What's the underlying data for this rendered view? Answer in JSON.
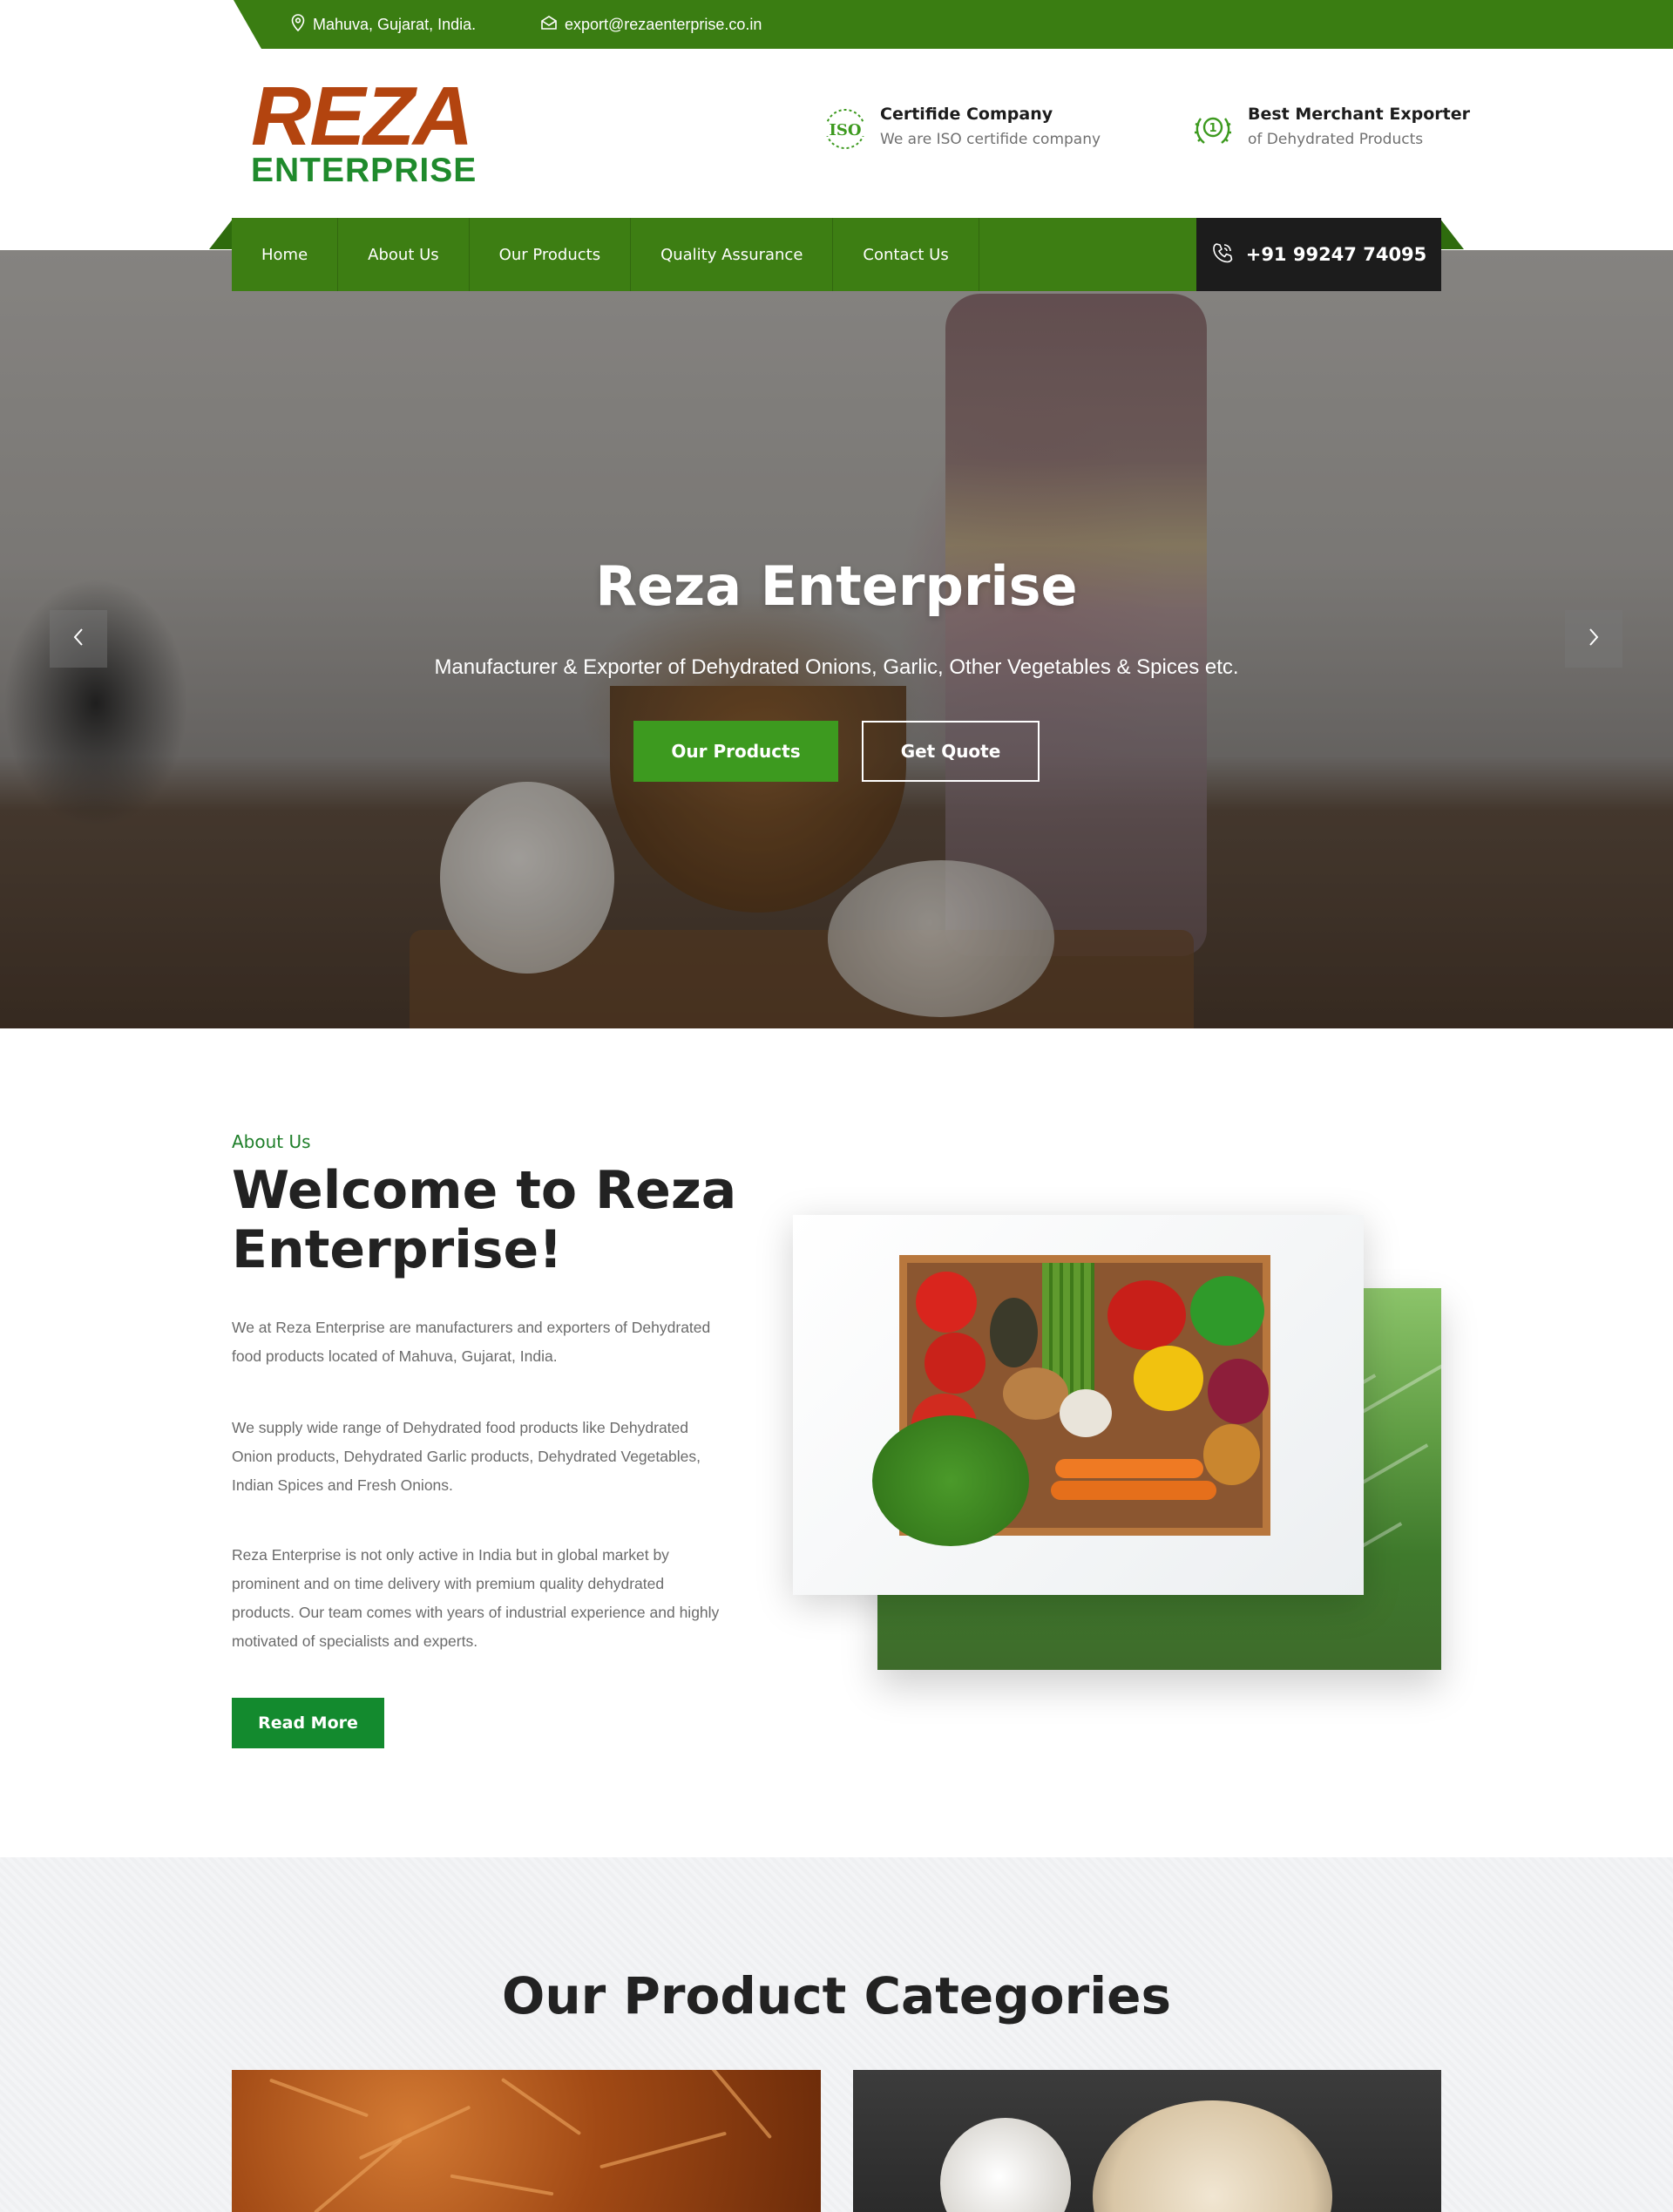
{
  "topbar": {
    "location": "Mahuva, Gujarat, India.",
    "email": "export@rezaenterprise.co.in",
    "location_icon": "map-pin-icon",
    "email_icon": "envelope-icon"
  },
  "logo": {
    "line1": "REZA",
    "line2": "ENTERPRISE"
  },
  "header_info": [
    {
      "title": "Certifide Company",
      "subtitle": "We are ISO certifide company",
      "icon": "iso-badge-icon",
      "icon_text": "ISO"
    },
    {
      "title": "Best Merchant Exporter",
      "subtitle": "of Dehydrated Products",
      "icon": "award-laurel-icon",
      "icon_text": "1"
    }
  ],
  "nav": {
    "items": [
      "Home",
      "About Us",
      "Our Products",
      "Quality Assurance",
      "Contact Us"
    ],
    "phone": "+91 99247 74095",
    "phone_icon": "phone-icon"
  },
  "hero": {
    "title": "Reza Enterprise",
    "subtitle": "Manufacturer & Exporter of Dehydrated Onions, Garlic, Other Vegetables & Spices etc.",
    "primary_button": "Our Products",
    "secondary_button": "Get Quote",
    "prev_icon": "chevron-left-icon",
    "next_icon": "chevron-right-icon"
  },
  "about": {
    "label": "About Us",
    "title": "Welcome to Reza Enterprise!",
    "paragraphs": [
      "We at Reza Enterprise are manufacturers and exporters of Dehydrated food products located of Mahuva, Gujarat, India.",
      "We supply wide range of Dehydrated food products like Dehydrated Onion products, Dehydrated Garlic products, Dehydrated Vegetables, Indian Spices and Fresh Onions.",
      "Reza Enterprise is not only active in India but in global market by prominent and on time delivery with premium quality dehydrated products. Our team comes with years of industrial experience and highly motivated of specialists and experts."
    ],
    "button": "Read More"
  },
  "categories": {
    "title": "Our Product Categories"
  },
  "colors": {
    "brand_green": "#3d7e13",
    "accent_green": "#3d9a1f",
    "logo_orange": "#b3440f",
    "logo_green": "#1f8a2c",
    "dark": "#1c1c1c"
  }
}
